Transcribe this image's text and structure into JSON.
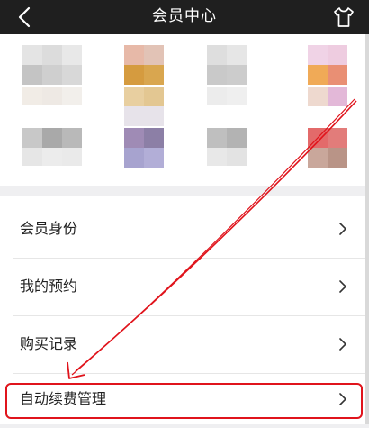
{
  "navbar": {
    "title": "会员中心",
    "back_icon": "chevron-left-icon",
    "right_icon": "shirt-icon"
  },
  "menu": {
    "items": [
      {
        "label": "会员身份",
        "icon": "chevron-right-icon"
      },
      {
        "label": "我的预约",
        "icon": "chevron-right-icon"
      },
      {
        "label": "购买记录",
        "icon": "chevron-right-icon"
      },
      {
        "label": "自动续费管理",
        "icon": "chevron-right-icon"
      }
    ]
  },
  "annotation": {
    "color": "#e0141c",
    "target": "自动续费管理"
  },
  "colors": {
    "navbar_bg": "#1f1f1f",
    "page_bg": "#efeff1",
    "highlight": "#e0141c"
  }
}
